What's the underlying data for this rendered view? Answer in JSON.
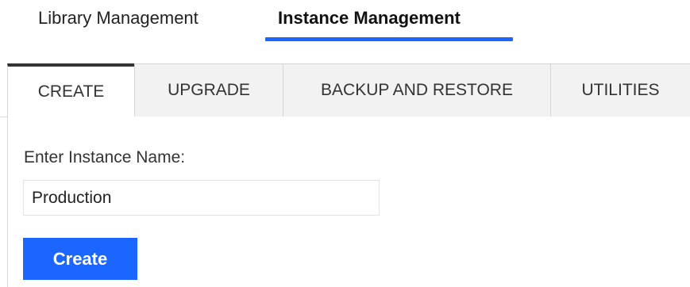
{
  "top_nav": {
    "tabs": [
      {
        "label": "Library Management",
        "active": false
      },
      {
        "label": "Instance Management",
        "active": true
      }
    ],
    "accent_color": "#1a66ff"
  },
  "sub_tabs": [
    {
      "label": "CREATE",
      "active": true
    },
    {
      "label": "UPGRADE",
      "active": false
    },
    {
      "label": "BACKUP AND RESTORE",
      "active": false
    },
    {
      "label": "UTILITIES",
      "active": false
    }
  ],
  "create_form": {
    "field_label": "Enter Instance Name:",
    "instance_name_value": "Production",
    "submit_label": "Create"
  }
}
